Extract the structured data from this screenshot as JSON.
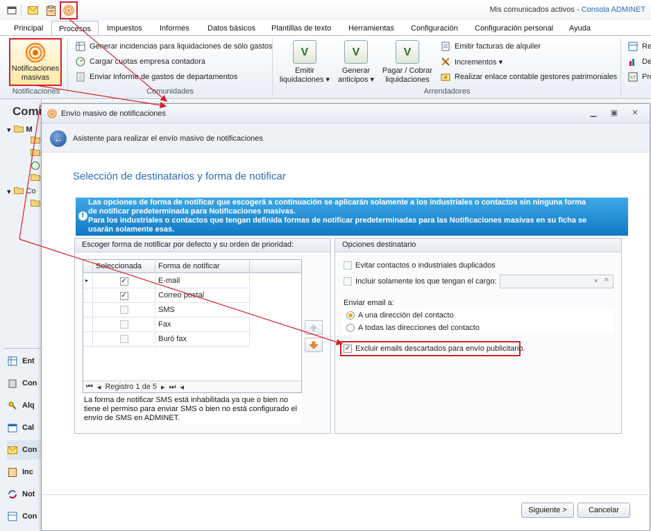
{
  "app": {
    "title_prefix": "Mis comunicados activos - ",
    "title_brand": "Consola ADMINET"
  },
  "quick_access": [
    "window-icon",
    "envelope-icon",
    "clipboard-icon",
    "broadcast-icon"
  ],
  "ribbon_tabs": [
    "Principal",
    "Procesos",
    "Impuestos",
    "Informes",
    "Datos básicos",
    "Plantillas de texto",
    "Herramientas",
    "Configuración",
    "Configuración personal",
    "Ayuda"
  ],
  "ribbon": {
    "notificaciones": {
      "button_line1": "Notificaciones",
      "button_line2": "masivas",
      "group_label": "Notificaciones"
    },
    "comunidades": {
      "items": [
        "Generar incidencias para liquidaciones de sólo gastos",
        "Cargar cuotas empresa contadora",
        "Enviar informe de gastos de departamentos"
      ],
      "group_label": "Comunidades"
    },
    "arrendadores": {
      "big_buttons": [
        {
          "line1": "Emitir",
          "line2": "liquidaciones ▾"
        },
        {
          "line1": "Generar",
          "line2": "anticipos ▾"
        },
        {
          "line1": "Pagar / Cobrar",
          "line2": "liquidaciones"
        }
      ],
      "small_items": [
        "Emitir facturas de alquiler",
        "Incrementos ▾",
        "Realizar enlace contable gestores patrimoniales"
      ],
      "group_label": "Arrendadores"
    },
    "extra_items": [
      "Re",
      "De",
      "Pro"
    ]
  },
  "left_pane": {
    "title": "Comu",
    "tree_labels": [
      "M",
      "Co"
    ],
    "nav_items": [
      "Ent",
      "Con",
      "Alq",
      "Cal",
      "Con",
      "Inc",
      "Not",
      "Con"
    ]
  },
  "dialog": {
    "title": "Envío masivo de notificaciones",
    "wizard_text": "Asistente para realizar el envío masivo de notificaciones",
    "section_title": "Selección de destinatarios y forma de notificar",
    "info_lines": [
      "Las opciones de forma de notificar que escogerá a continuación se aplicarán solamente a los industriales o contactos sin ninguna forma",
      "de notificar predeterminada para Notificaciones masivas.",
      "Para los  industriales o contactos que tengan definida formas de notificar predeterminadas para las Notificaciones masivas en su ficha se",
      "usarán solamente esas."
    ],
    "left_panel": {
      "header": "Escoger forma de notificar por defecto y su orden de prioridad:",
      "columns": [
        "Seleccionada",
        "Forma de notificar"
      ],
      "rows": [
        {
          "selected": true,
          "name": "E-mail"
        },
        {
          "selected": true,
          "name": "Correo postal"
        },
        {
          "selected": false,
          "name": "SMS"
        },
        {
          "selected": false,
          "name": "Fax"
        },
        {
          "selected": false,
          "name": "Buró fax"
        }
      ],
      "nav_text": "Registro 1 de 5",
      "note": "La forma de notificar SMS está inhabilitada ya que o bien no tiene el permiso para enviar SMS o bien no está configurado el envío de SMS en ADMINET."
    },
    "right_panel": {
      "header": "Opciones destinatario",
      "avoid_duplicates": "Evitar contactos o industriales duplicados",
      "include_only_cargo": "Incluir solamente los que tengan el cargo:",
      "send_email_label": "Enviar email a:",
      "radio_one": "A una dirección del contacto",
      "radio_all": "A todas las direcciones del contacto",
      "exclude_discarded": "Excluir emails descartados para envío publicitario."
    },
    "buttons": {
      "next": "Siguiente >",
      "cancel": "Cancelar"
    }
  },
  "colors": {
    "highlight": "#d3202a",
    "accent_blue": "#2e6bb8",
    "info_bar": "#1179c4"
  }
}
